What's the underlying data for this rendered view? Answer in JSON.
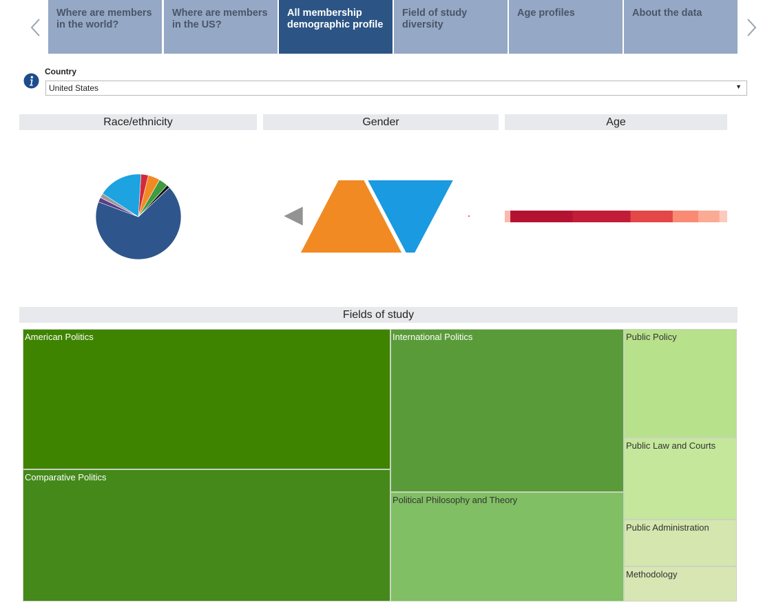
{
  "nav": {
    "tabs": [
      {
        "label": "Where are members in the world?",
        "active": false
      },
      {
        "label": "Where are members in the US?",
        "active": false
      },
      {
        "label": "All membership demographic profile",
        "active": true
      },
      {
        "label": "Field of study diversity",
        "active": false
      },
      {
        "label": "Age profiles",
        "active": false
      },
      {
        "label": "About the data",
        "active": false
      }
    ],
    "prev_icon": "chevron-left-icon",
    "next_icon": "chevron-right-icon"
  },
  "filter": {
    "icon": "info-icon",
    "label": "Country",
    "selected": "United States"
  },
  "sections": {
    "race": "Race/ethnicity",
    "gender": "Gender",
    "age": "Age",
    "fields": "Fields of study"
  },
  "colors": {
    "tab": "#95a8c5",
    "tab_active": "#2c5585",
    "header_bg": "#e7e9ed"
  },
  "chart_data": [
    {
      "type": "pie",
      "title": "Race/ethnicity",
      "slices": [
        {
          "value": 2.8,
          "color": "#d62839"
        },
        {
          "value": 4.5,
          "color": "#f28a24"
        },
        {
          "value": 3.5,
          "color": "#3f9a40"
        },
        {
          "value": 1.2,
          "color": "#111111"
        },
        {
          "value": 67.7,
          "color": "#2e568c"
        },
        {
          "value": 1.8,
          "color": "#5a3d8a"
        },
        {
          "value": 1.7,
          "color": "#9a9a9a"
        },
        {
          "value": 16.8,
          "color": "#1ca3e0"
        }
      ]
    },
    {
      "type": "bar",
      "title": "Gender",
      "marks": [
        {
          "shape": "triangle-left",
          "value": 0.6,
          "color": "#939393"
        },
        {
          "shape": "triangle-up",
          "value": 2.3,
          "color": "#f28a24"
        },
        {
          "shape": "triangle-down",
          "value": 1.8,
          "color": "#1a9ae0"
        },
        {
          "shape": "dot",
          "value": 0.05,
          "color": "#d62839"
        }
      ]
    },
    {
      "type": "bar",
      "title": "Age",
      "segments": [
        {
          "value": 2.5,
          "color": "#fbb9ad"
        },
        {
          "value": 28,
          "color": "#b41233"
        },
        {
          "value": 26,
          "color": "#c21c38"
        },
        {
          "value": 19,
          "color": "#e44747"
        },
        {
          "value": 11.5,
          "color": "#f98a74"
        },
        {
          "value": 9.5,
          "color": "#fbaa94"
        },
        {
          "value": 3.5,
          "color": "#fcc9bd"
        }
      ]
    },
    {
      "type": "treemap",
      "title": "Fields of study",
      "items": [
        {
          "label": "American Politics",
          "value": 20.7,
          "color": "#3e8400",
          "text": "#ffffff"
        },
        {
          "label": "Comparative Politics",
          "value": 19.4,
          "color": "#44891a",
          "text": "#ffffff"
        },
        {
          "label": "International Politics",
          "value": 15.2,
          "color": "#5a9b39",
          "text": "#ffffff"
        },
        {
          "label": "Political Philosophy and Theory",
          "value": 10.2,
          "color": "#80bf63",
          "text": "#333333"
        },
        {
          "label": "Public Policy",
          "value": 4.9,
          "color": "#b8e18b",
          "text": "#333333"
        },
        {
          "label": "Public Law and Courts",
          "value": 3.7,
          "color": "#c5e79b",
          "text": "#333333"
        },
        {
          "label": "Public Administration",
          "value": 2.1,
          "color": "#d5e6ae",
          "text": "#333333"
        },
        {
          "label": "Methodology",
          "value": 1.6,
          "color": "#d8e6b3",
          "text": "#333333"
        }
      ]
    }
  ]
}
